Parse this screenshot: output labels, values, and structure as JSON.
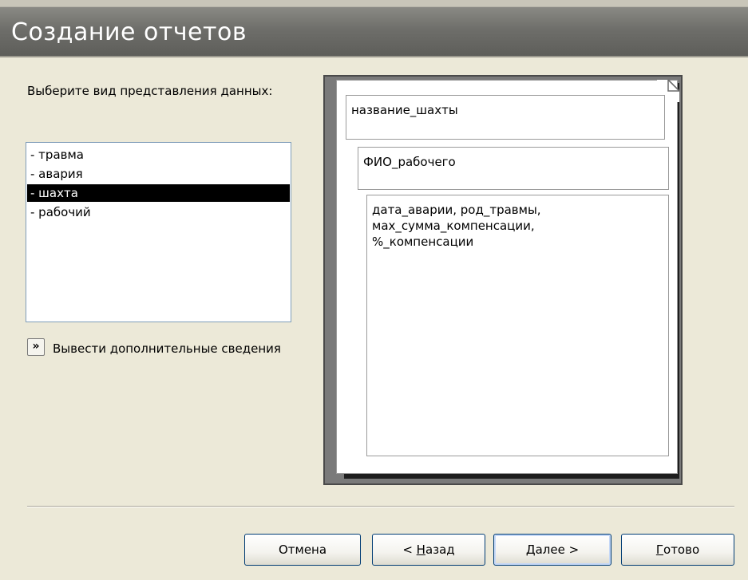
{
  "window": {
    "title": "Создание отчетов"
  },
  "left": {
    "prompt": "Выберите вид представления данных:",
    "list": [
      {
        "label": "- травма",
        "selected": false
      },
      {
        "label": "- авария",
        "selected": false
      },
      {
        "label": "- шахта",
        "selected": true
      },
      {
        "label": "- рабочий",
        "selected": false
      }
    ],
    "more_button_icon": "double-chevron-right-icon",
    "more_label": "Вывести дополнительные сведения"
  },
  "preview": {
    "level1": "название_шахты",
    "level2": "ФИО_рабочего",
    "details": [
      "дата_аварии, род_травмы,",
      "мах_сумма_компенсации,",
      "%_компенсации"
    ]
  },
  "buttons": {
    "cancel": "Отмена",
    "back_prefix": "< ",
    "back_mnemonic": "Н",
    "back_rest": "азад",
    "next_mnemonic": "Д",
    "next_rest": "алее >",
    "finish_mnemonic": "Г",
    "finish_rest": "отово"
  },
  "colors": {
    "header": "#6e6e6a",
    "dialog_bg": "#ece9d8",
    "selection": "#000000"
  }
}
